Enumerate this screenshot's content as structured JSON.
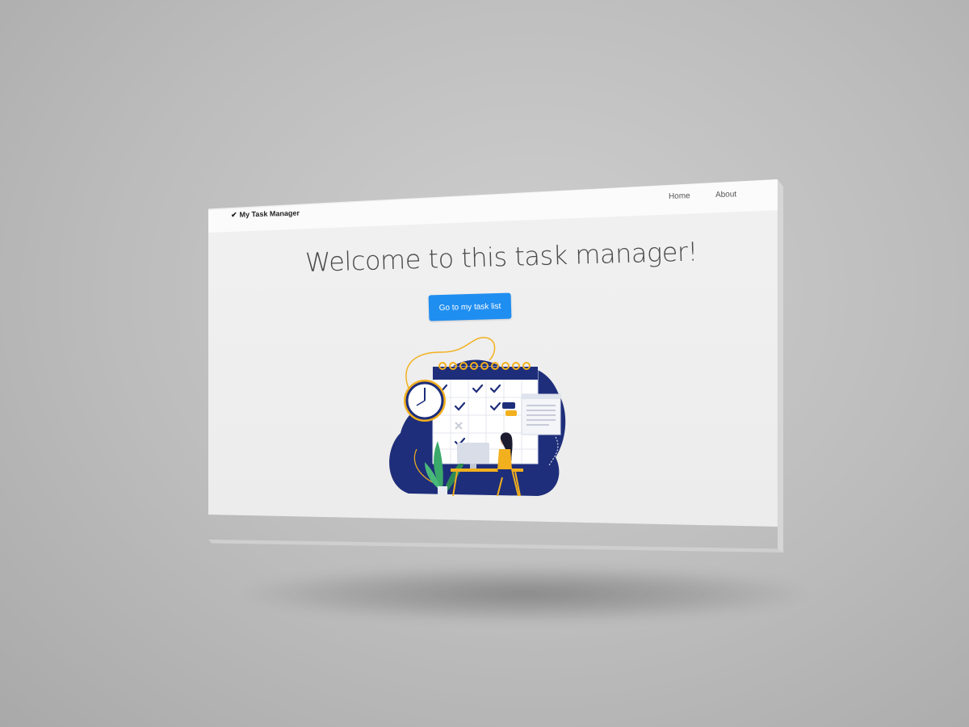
{
  "navbar": {
    "brand_label": "My Task Manager",
    "brand_icon": "checkmark-icon",
    "links": [
      {
        "label": "Home"
      },
      {
        "label": "About"
      }
    ]
  },
  "hero": {
    "title": "Welcome to this task manager!",
    "cta_label": "Go to my task list"
  },
  "illustration": {
    "name": "task-calendar-illustration"
  },
  "colors": {
    "primary_button": "#1f8ef1",
    "illustration_navy": "#1e2e7a",
    "illustration_yellow": "#f2b01e",
    "background_gray": "#bcbcbc"
  }
}
